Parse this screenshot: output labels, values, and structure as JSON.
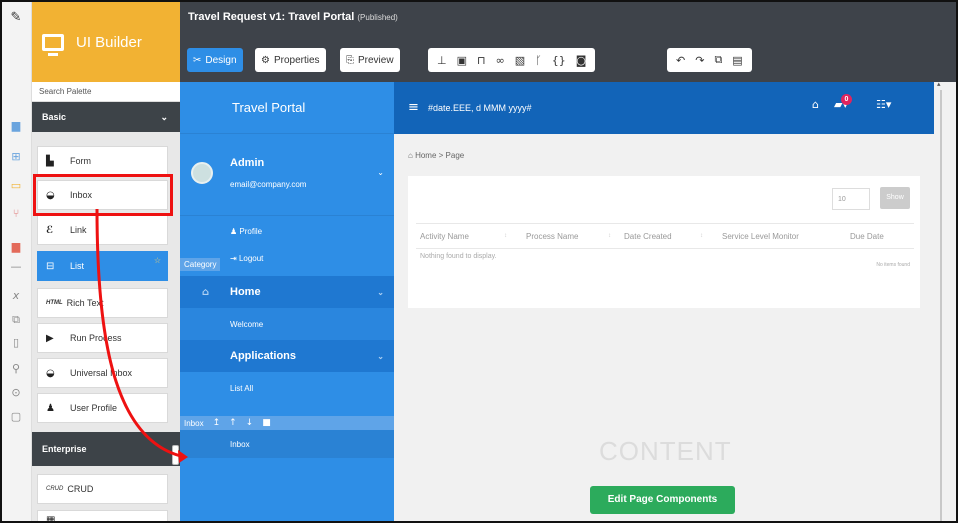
{
  "palette": {
    "title": "UI Builder",
    "search_label": "Search Palette",
    "category_basic": "Basic",
    "category_enterprise": "Enterprise",
    "items": [
      {
        "label": "Form",
        "icon": "form-icon"
      },
      {
        "label": "Inbox",
        "icon": "inbox-icon"
      },
      {
        "label": "Link",
        "icon": "link-icon"
      },
      {
        "label": "List",
        "icon": "list-icon"
      },
      {
        "label": "Rich Text",
        "icon": "html-icon",
        "tag": "HTML"
      },
      {
        "label": "Run Process",
        "icon": "play-icon"
      },
      {
        "label": "Universal Inbox",
        "icon": "inbox-icon"
      },
      {
        "label": "User Profile",
        "icon": "user-icon"
      },
      {
        "label": "CRUD",
        "icon": "crud-icon",
        "tag": "CRUD"
      }
    ]
  },
  "header": {
    "title": "Travel Request v1: Travel Portal",
    "status": "(Published)",
    "design_label": "Design",
    "properties_label": "Properties",
    "preview_label": "Preview"
  },
  "portal": {
    "title": "Travel Portal",
    "user_name": "Admin",
    "user_email": "email@company.com",
    "profile_label": "Profile",
    "logout_label": "Logout",
    "category_tag": "Category",
    "home_label": "Home",
    "welcome_label": "Welcome",
    "applications_label": "Applications",
    "listall_label": "List All",
    "inbox_toolbar_label": "Inbox",
    "inbox_label": "Inbox"
  },
  "content": {
    "date_format": "#date.EEE, d MMM yyyy#",
    "notification_count": "0",
    "breadcrumb": "Home > Page",
    "page_size": "10",
    "search_label": "Show",
    "columns": [
      "Activity Name",
      "Process Name",
      "Date Created",
      "Service Level Monitor",
      "Due Date"
    ],
    "empty_message": "Nothing found to display.",
    "no_items": "No items found",
    "watermark": "CONTENT",
    "edit_button": "Edit Page Components"
  },
  "colors": {
    "accent": "#2e8ee6",
    "brand": "#f2b233",
    "highlight": "#ee1111",
    "action": "#2cab5c"
  }
}
